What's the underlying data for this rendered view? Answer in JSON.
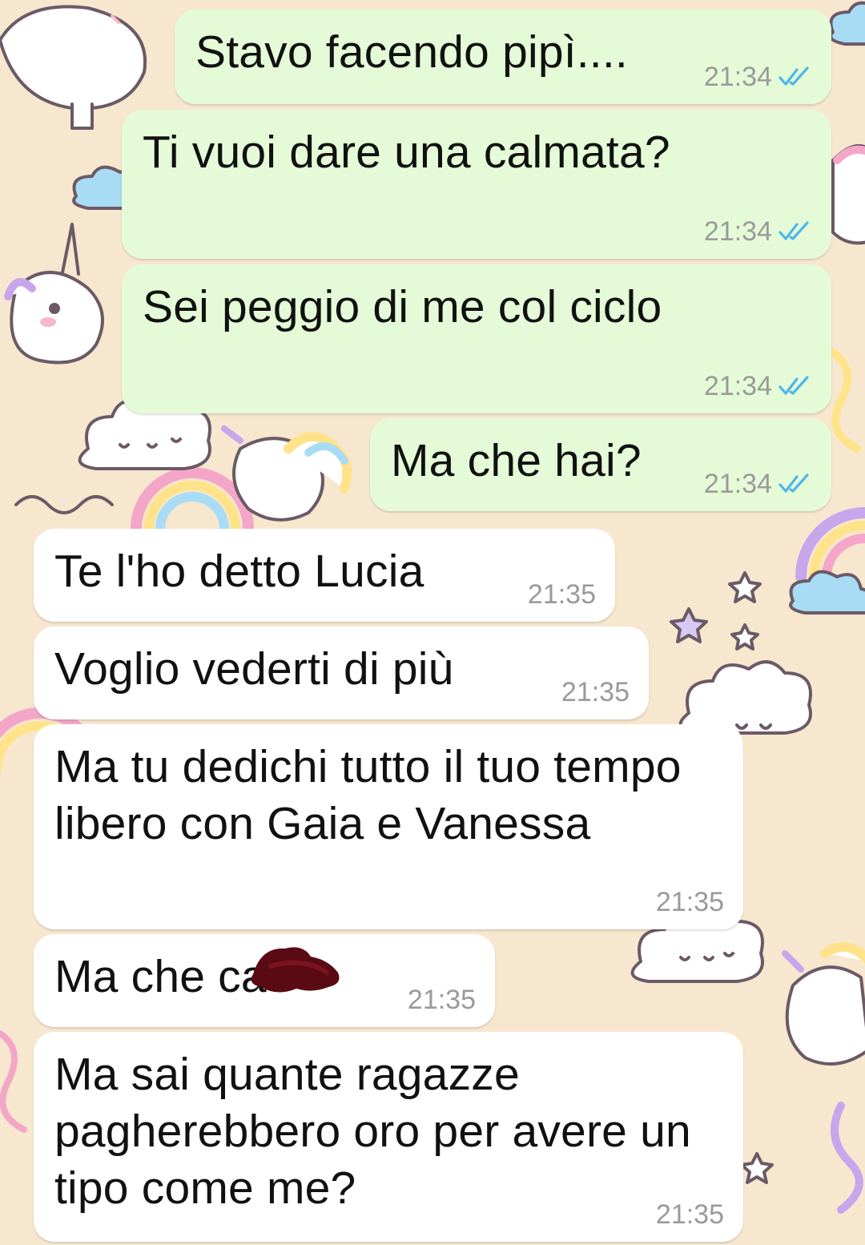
{
  "conversation": {
    "messages": [
      {
        "direction": "outgoing",
        "text": "Stavo facendo pipì....",
        "time": "21:34",
        "status_icon": "double-check-read-icon"
      },
      {
        "direction": "outgoing",
        "text": "Ti vuoi dare una calmata?",
        "time": "21:34",
        "status_icon": "double-check-read-icon"
      },
      {
        "direction": "outgoing",
        "text": "Sei peggio di me col ciclo",
        "time": "21:34",
        "status_icon": "double-check-read-icon"
      },
      {
        "direction": "outgoing",
        "text": "Ma che hai?",
        "time": "21:34",
        "status_icon": "double-check-read-icon"
      },
      {
        "direction": "incoming",
        "text": "Te l'ho detto Lucia",
        "time": "21:35"
      },
      {
        "direction": "incoming",
        "text": "Voglio vederti di più",
        "time": "21:35"
      },
      {
        "direction": "incoming",
        "text": "Ma tu dedichi tutto il tuo tempo\nlibero con Gaia e Vanessa",
        "time": "21:35"
      },
      {
        "direction": "incoming",
        "text": "Ma che ca",
        "time": "21:35",
        "redacted": true
      },
      {
        "direction": "incoming",
        "text": "Ma sai quante ragazze\npagherebbero oro per avere un\ntipo come me?",
        "time": "21:35"
      }
    ]
  },
  "colors": {
    "wallpaper": "#f7e7cf",
    "outgoing_bubble": "#e5fbd7",
    "incoming_bubble": "#ffffff",
    "read_check": "#4fb6ec",
    "redaction": "#5a0a12"
  }
}
